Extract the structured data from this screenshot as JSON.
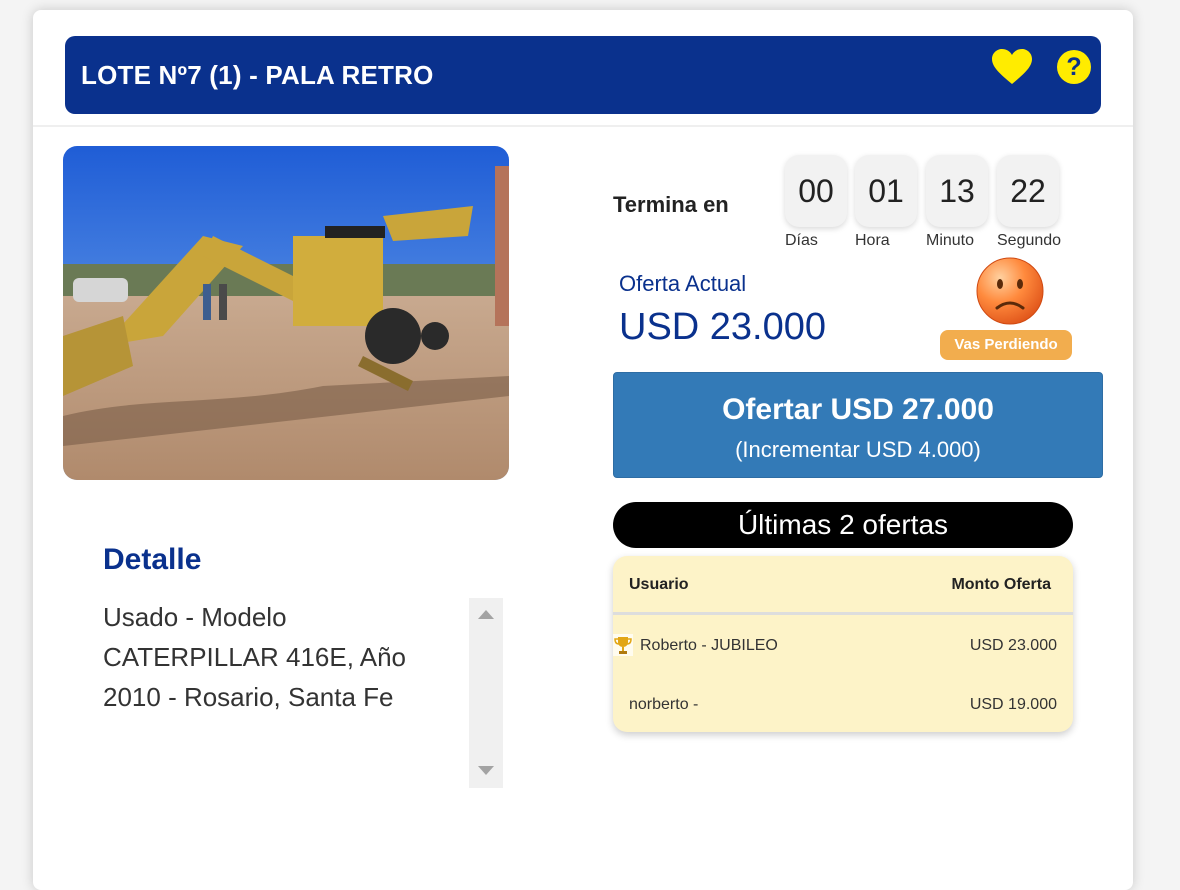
{
  "header": {
    "title": "LOTE Nº7 (1) - PALA RETRO",
    "favorite_icon": "heart-icon",
    "help_icon": "question-icon",
    "help_glyph": "?",
    "accent_color": "#0a318d",
    "icon_color": "#ffec00"
  },
  "photo": {
    "alt": "Pala retro CATERPILLAR 416E"
  },
  "detalle": {
    "title": "Detalle",
    "text": "Usado - Modelo CATERPILLAR 416E, Año 2010 - Rosario, Santa Fe"
  },
  "countdown": {
    "label": "Termina en",
    "units": [
      {
        "value": "00",
        "label": "Días"
      },
      {
        "value": "01",
        "label": "Hora"
      },
      {
        "value": "13",
        "label": "Minuto"
      },
      {
        "value": "22",
        "label": "Segundo"
      }
    ]
  },
  "current_offer": {
    "label": "Oferta Actual",
    "value": "USD 23.000"
  },
  "status": {
    "label": "Vas Perdiendo",
    "icon": "sad-face-icon",
    "color": "#f2ad4e"
  },
  "bid_button": {
    "main": "Ofertar USD 27.000",
    "sub": "(Incrementar USD 4.000)",
    "color": "#337ab7"
  },
  "offers": {
    "title": "Últimas 2 ofertas",
    "columns": [
      "Usuario",
      "Monto Oferta"
    ],
    "rows": [
      {
        "user": "Roberto - JUBILEO",
        "amount": "USD 23.000",
        "icon": "trophy-icon"
      },
      {
        "user": "norberto -",
        "amount": "USD 19.000"
      }
    ]
  }
}
